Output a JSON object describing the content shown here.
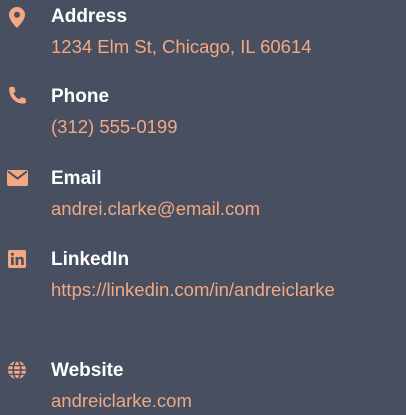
{
  "accent_color": "#f3a882",
  "background_color": "#474f61",
  "contacts": [
    {
      "label": "Address",
      "value": "1234 Elm St, Chicago, IL 60614",
      "icon": "map-pin-icon"
    },
    {
      "label": "Phone",
      "value": "(312) 555-0199",
      "icon": "phone-icon"
    },
    {
      "label": "Email",
      "value": "andrei.clarke@email.com",
      "icon": "envelope-icon"
    },
    {
      "label": "LinkedIn",
      "value": "https://linkedin.com/in/andreiclarke",
      "icon": "linkedin-icon"
    },
    {
      "label": "Website",
      "value": "andreiclarke.com",
      "icon": "globe-icon"
    }
  ]
}
